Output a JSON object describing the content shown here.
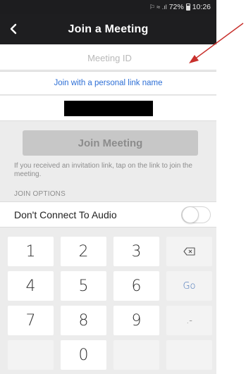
{
  "status_bar": {
    "signal": "⚐ ≈ .ıl",
    "battery_percent": "72%",
    "time": "10:26"
  },
  "header": {
    "back_label": "<",
    "title": "Join a Meeting"
  },
  "form": {
    "meeting_id_placeholder": "Meeting ID",
    "personal_link_label": "Join with a personal link name",
    "join_button_label": "Join Meeting",
    "hint_text": "If you received an invitation link, tap on the link to join the meeting."
  },
  "options": {
    "section_label": "JOIN OPTIONS",
    "audio_label": "Don't Connect To Audio",
    "audio_toggle_on": false
  },
  "keyboard": {
    "keys": [
      [
        "1",
        "2",
        "3",
        "⌫"
      ],
      [
        "4",
        "5",
        "6",
        "Go"
      ],
      [
        "7",
        "8",
        "9",
        ".-"
      ],
      [
        "",
        "0",
        "",
        ""
      ]
    ]
  },
  "colors": {
    "nav_bg": "#1e1e20",
    "link_blue": "#2d6fd6",
    "join_button_bg": "#c7c7c7",
    "arrow_red": "#c8302c"
  }
}
